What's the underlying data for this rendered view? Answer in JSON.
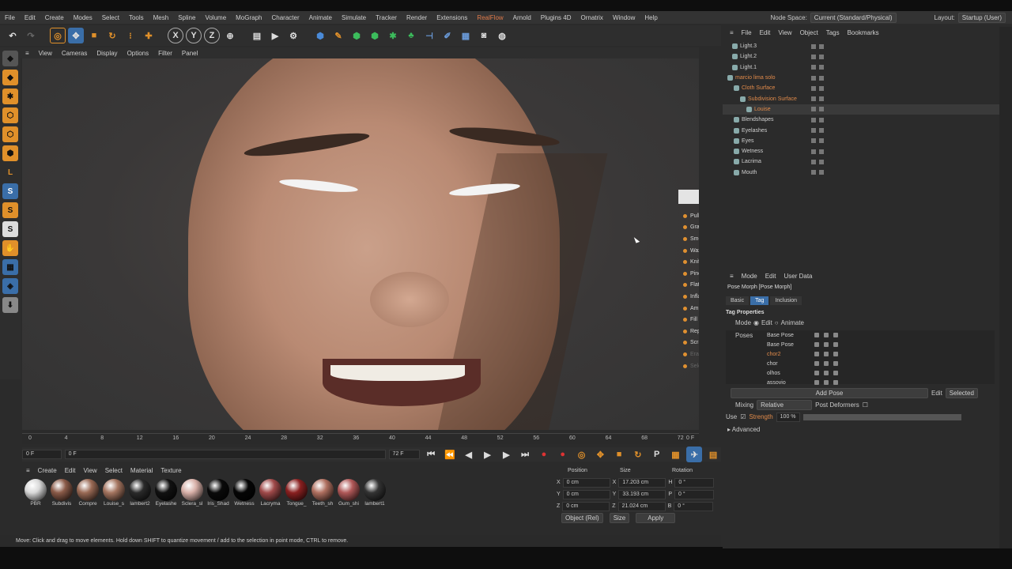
{
  "menu": [
    "File",
    "Edit",
    "Create",
    "Modes",
    "Select",
    "Tools",
    "Mesh",
    "Spline",
    "Volume",
    "MoGraph",
    "Character",
    "Animate",
    "Simulate",
    "Tracker",
    "Render",
    "Extensions",
    "RealFlow",
    "Arnold",
    "Plugins 4D",
    "Ornatrix",
    "Window",
    "Help"
  ],
  "nodespace": {
    "label": "Node Space:",
    "value": "Current (Standard/Physical)",
    "layout_label": "Layout:",
    "layout_value": "Startup (User)"
  },
  "viewport_menu": [
    "View",
    "Cameras",
    "Display",
    "Options",
    "Filter",
    "Panel"
  ],
  "sculpt_tools": [
    "Pull",
    "Grab",
    "Smooth",
    "Wax",
    "Knife",
    "Pinch",
    "Flatten",
    "Inflate",
    "Amplify",
    "Fill",
    "Repeat",
    "Scrape",
    "Erase",
    "Select"
  ],
  "timeline": {
    "ticks": [
      "0",
      "4",
      "8",
      "12",
      "16",
      "20",
      "24",
      "28",
      "32",
      "36",
      "40",
      "44",
      "48",
      "52",
      "56",
      "60",
      "64",
      "68",
      "72"
    ],
    "frame_end": "0 F",
    "start": "0 F",
    "current": "0 F",
    "end": "72 F",
    "end2": "72 F"
  },
  "materials": {
    "menu": [
      "Create",
      "Edit",
      "View",
      "Select",
      "Material",
      "Texture"
    ],
    "items": [
      {
        "name": "PBR",
        "color": "#d9d9d9"
      },
      {
        "name": "Subdivis",
        "color": "#8a5a48"
      },
      {
        "name": "Compre",
        "color": "#9a6a55"
      },
      {
        "name": "Louise_s",
        "color": "#a57560"
      },
      {
        "name": "lambert2",
        "color": "#2a2a2a"
      },
      {
        "name": "Eyelashe",
        "color": "#111"
      },
      {
        "name": "Sclera_sl",
        "color": "#d8b0a8"
      },
      {
        "name": "Iris_Shad",
        "color": "#0a0a0a"
      },
      {
        "name": "Wetness",
        "color": "#050505"
      },
      {
        "name": "Lacryma",
        "color": "#a04a4a"
      },
      {
        "name": "Tongue_",
        "color": "#8a2020"
      },
      {
        "name": "Teeth_sh",
        "color": "#b07060"
      },
      {
        "name": "Gum_shi",
        "color": "#b05858"
      },
      {
        "name": "lambert1",
        "color": "#333"
      }
    ]
  },
  "coords": {
    "headers": [
      "Position",
      "Size",
      "Rotation"
    ],
    "rows": [
      {
        "axis": "X",
        "pos": "0 cm",
        "size": "17.203 cm",
        "rot_label": "H",
        "rot": "0 °"
      },
      {
        "axis": "Y",
        "pos": "0 cm",
        "size": "33.193 cm",
        "rot_label": "P",
        "rot": "0 °"
      },
      {
        "axis": "Z",
        "pos": "0 cm",
        "size": "21.024 cm",
        "rot_label": "B",
        "rot": "0 °"
      }
    ],
    "mode": "Object (Rel)",
    "size_mode": "Size",
    "apply": "Apply"
  },
  "status": "Move: Click and drag to move elements. Hold down SHIFT to quantize movement / add to the selection in point mode, CTRL to remove.",
  "objects": {
    "menu": [
      "File",
      "Edit",
      "View",
      "Object",
      "Tags",
      "Bookmarks"
    ],
    "items": [
      {
        "name": "Light.3",
        "indent": 8,
        "style": ""
      },
      {
        "name": "Light.2",
        "indent": 8,
        "style": ""
      },
      {
        "name": "Light.1",
        "indent": 8,
        "style": ""
      },
      {
        "name": "marcio lima solo",
        "indent": 2,
        "style": "orange"
      },
      {
        "name": "Cloth Surface",
        "indent": 10,
        "style": "orange"
      },
      {
        "name": "Subdivision Surface",
        "indent": 18,
        "style": "orange"
      },
      {
        "name": "Louise",
        "indent": 26,
        "style": "orange sel"
      },
      {
        "name": "Blendshapes",
        "indent": 10,
        "style": ""
      },
      {
        "name": "Eyelashes",
        "indent": 10,
        "style": ""
      },
      {
        "name": "Eyes",
        "indent": 10,
        "style": ""
      },
      {
        "name": "Wetness",
        "indent": 10,
        "style": ""
      },
      {
        "name": "Lacrima",
        "indent": 10,
        "style": ""
      },
      {
        "name": "Mouth",
        "indent": 10,
        "style": ""
      }
    ]
  },
  "attributes": {
    "menu": [
      "Mode",
      "Edit",
      "User Data"
    ],
    "title": "Pose Morph [Pose Morph]",
    "tabs": [
      "Basic",
      "Tag",
      "Inclusion"
    ],
    "tag_properties": "Tag Properties",
    "mode_label": "Mode",
    "mode_edit": "Edit",
    "mode_animate": "Animate",
    "poses_label": "Poses",
    "poses": [
      {
        "name": "Base Pose",
        "sel": false
      },
      {
        "name": "Base Pose",
        "sel": false
      },
      {
        "name": "chor2",
        "sel": true
      },
      {
        "name": "chor",
        "sel": false
      },
      {
        "name": "olhos",
        "sel": false
      },
      {
        "name": "assovio",
        "sel": false
      }
    ],
    "add_pose": "Add Pose",
    "edit_label": "Edit",
    "edit_value": "Selected",
    "mixing_label": "Mixing",
    "mixing_value": "Relative",
    "post_deformers": "Post Deformers",
    "use": "Use",
    "strength_label": "Strength",
    "strength_value": "100 %",
    "advanced": "Advanced"
  }
}
